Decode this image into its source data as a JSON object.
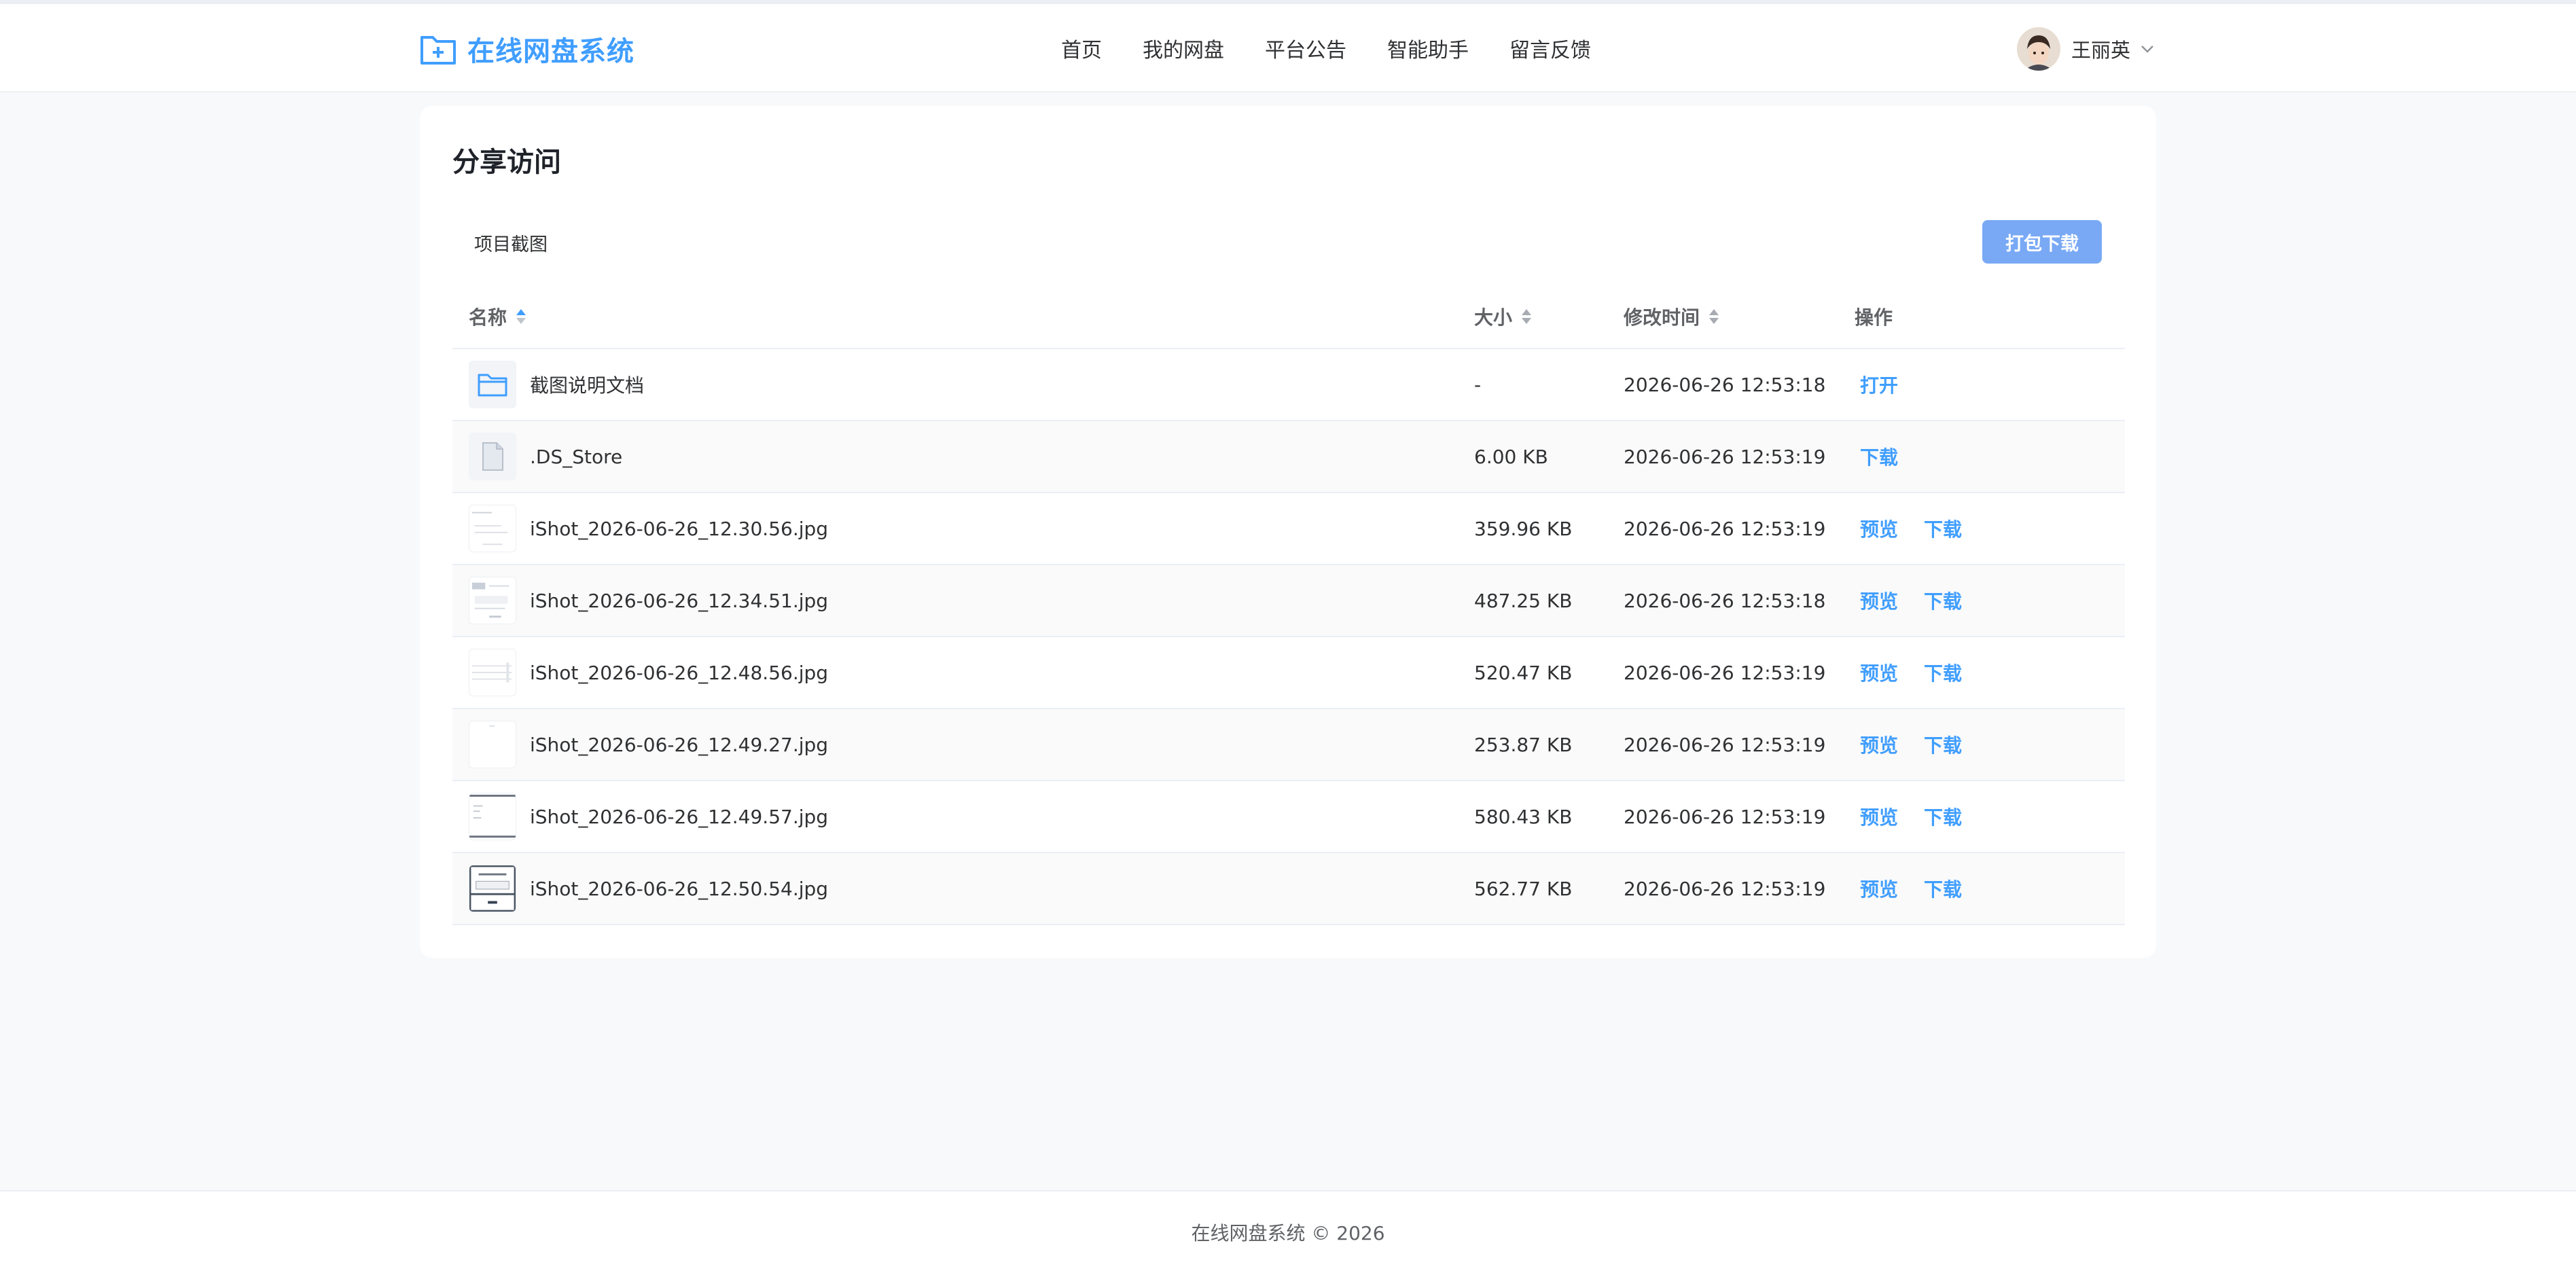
{
  "app": {
    "title": "在线网盘系统"
  },
  "nav": [
    {
      "label": "首页"
    },
    {
      "label": "我的网盘"
    },
    {
      "label": "平台公告"
    },
    {
      "label": "智能助手"
    },
    {
      "label": "留言反馈"
    }
  ],
  "user": {
    "name": "王丽英"
  },
  "page": {
    "title": "分享访问",
    "breadcrumb": "项目截图",
    "pack_download_label": "打包下载"
  },
  "table": {
    "headers": {
      "name": "名称",
      "size": "大小",
      "mtime": "修改时间",
      "ops": "操作"
    },
    "rows": [
      {
        "name": "截图说明文档",
        "size": "-",
        "mtime": "2026-06-26 12:53:18",
        "type": "folder",
        "ops": [
          "打开"
        ]
      },
      {
        "name": ".DS_Store",
        "size": "6.00 KB",
        "mtime": "2026-06-26 12:53:19",
        "type": "file",
        "ops": [
          "下载"
        ]
      },
      {
        "name": "iShot_2026-06-26_12.30.56.jpg",
        "size": "359.96 KB",
        "mtime": "2026-06-26 12:53:19",
        "type": "image",
        "ops": [
          "预览",
          "下载"
        ]
      },
      {
        "name": "iShot_2026-06-26_12.34.51.jpg",
        "size": "487.25 KB",
        "mtime": "2026-06-26 12:53:18",
        "type": "image",
        "ops": [
          "预览",
          "下载"
        ]
      },
      {
        "name": "iShot_2026-06-26_12.48.56.jpg",
        "size": "520.47 KB",
        "mtime": "2026-06-26 12:53:19",
        "type": "image",
        "ops": [
          "预览",
          "下载"
        ]
      },
      {
        "name": "iShot_2026-06-26_12.49.27.jpg",
        "size": "253.87 KB",
        "mtime": "2026-06-26 12:53:19",
        "type": "image",
        "ops": [
          "预览",
          "下载"
        ]
      },
      {
        "name": "iShot_2026-06-26_12.49.57.jpg",
        "size": "580.43 KB",
        "mtime": "2026-06-26 12:53:19",
        "type": "image",
        "ops": [
          "预览",
          "下载"
        ]
      },
      {
        "name": "iShot_2026-06-26_12.50.54.jpg",
        "size": "562.77 KB",
        "mtime": "2026-06-26 12:53:19",
        "type": "image",
        "ops": [
          "预览",
          "下载"
        ]
      }
    ]
  },
  "footer": {
    "text": "在线网盘系统 © 2026"
  },
  "colors": {
    "accent": "#409eff",
    "button": "#79a9f5"
  },
  "icons": {
    "logo": "folder-plus-icon",
    "folder": "folder-icon",
    "file": "file-icon",
    "sort": "sort-icon",
    "chevron": "chevron-down-icon"
  }
}
